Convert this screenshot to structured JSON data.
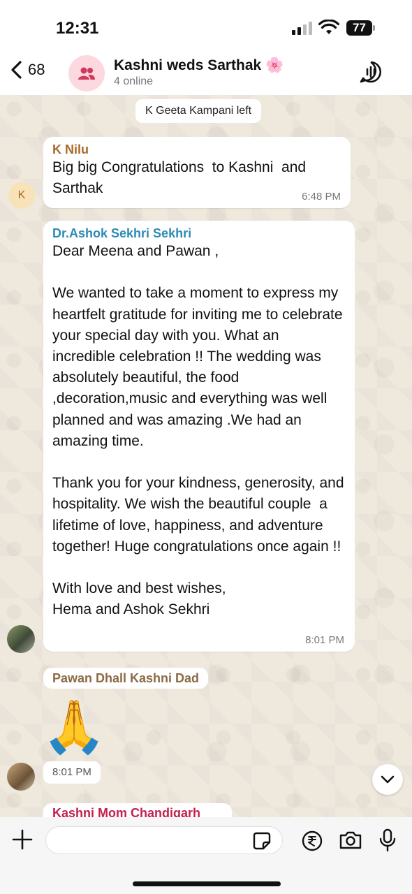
{
  "status_bar": {
    "time": "12:31",
    "battery": "77"
  },
  "header": {
    "back_count": "68",
    "title": "Kashni weds Sarthak 🌸",
    "subtitle": "4 online"
  },
  "system_message": "K Geeta Kampani left",
  "messages": [
    {
      "sender": "K Nilu",
      "avatar_initial": "K",
      "text": "Big big Congratulations  to Kashni  and Sarthak",
      "time": "6:48 PM"
    },
    {
      "sender": "Dr.Ashok Sekhri Sekhri",
      "text": "Dear Meena and Pawan ,\n\nWe wanted to take a moment to express my heartfelt gratitude for inviting me to celebrate your special day with you. What an incredible celebration !! The wedding was absolutely beautiful, the food ,decoration,music and everything was well planned and was amazing .We had an amazing time.\n\nThank you for your kindness, generosity, and hospitality. We wish the beautiful couple  a lifetime of love, happiness, and adventure together! Huge congratulations once again !!\n\nWith love and best wishes,\nHema and Ashok Sekhri",
      "time": "8:01 PM"
    },
    {
      "sender": "Pawan Dhall Kashni Dad",
      "text": "🙏",
      "time": "8:01 PM"
    },
    {
      "sender": "Kashni Mom Chandigarh"
    }
  ]
}
